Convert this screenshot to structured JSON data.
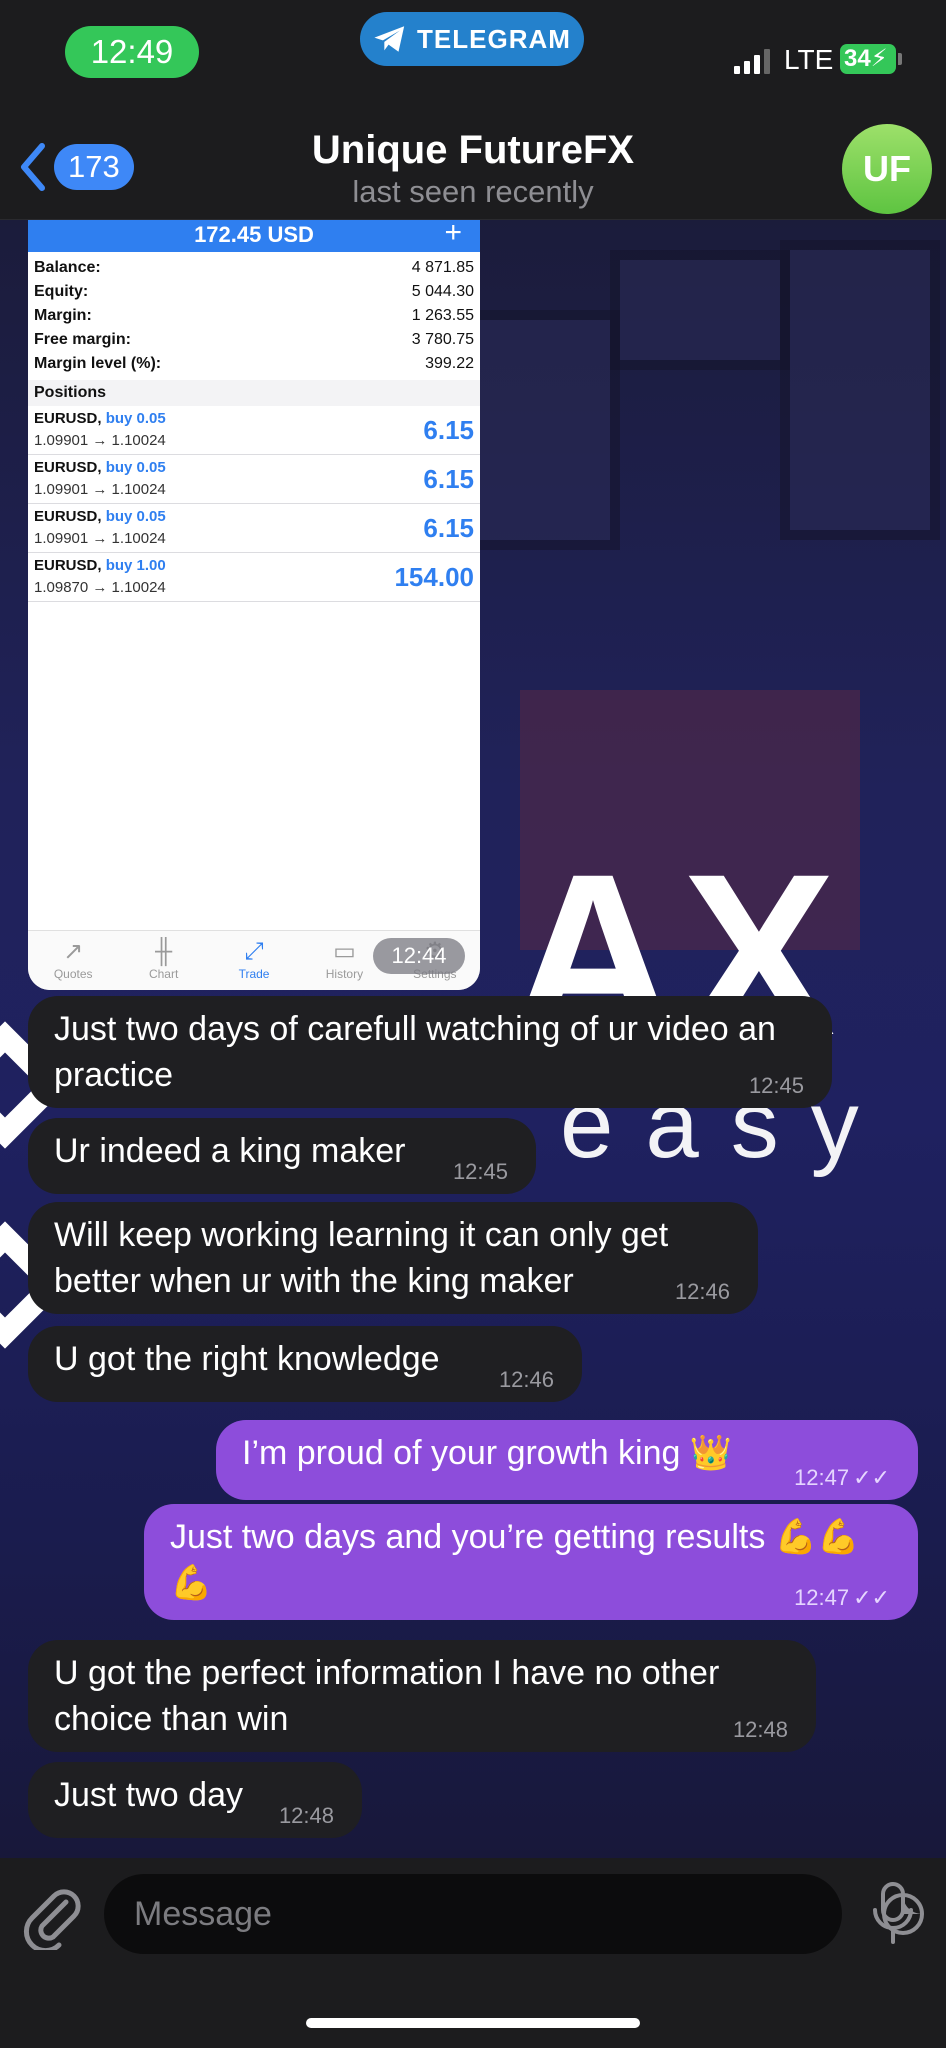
{
  "status": {
    "time": "12:49",
    "app_pill": "TELEGRAM",
    "network": "LTE",
    "battery": "34"
  },
  "header": {
    "back_count": "173",
    "title": "Unique FutureFX",
    "subtitle": "last seen recently",
    "avatar_initials": "UF"
  },
  "screenshot": {
    "top_value": "172.45 USD",
    "account": [
      {
        "label": "Balance:",
        "value": "4 871.85"
      },
      {
        "label": "Equity:",
        "value": "5 044.30"
      },
      {
        "label": "Margin:",
        "value": "1 263.55"
      },
      {
        "label": "Free margin:",
        "value": "3 780.75"
      },
      {
        "label": "Margin level (%):",
        "value": "399.22"
      }
    ],
    "positions_header": "Positions",
    "positions": [
      {
        "symbol": "EURUSD,",
        "side": "buy 0.05",
        "range": "1.09901 → 1.10024",
        "profit": "6.15"
      },
      {
        "symbol": "EURUSD,",
        "side": "buy 0.05",
        "range": "1.09901 → 1.10024",
        "profit": "6.15"
      },
      {
        "symbol": "EURUSD,",
        "side": "buy 0.05",
        "range": "1.09901 → 1.10024",
        "profit": "6.15"
      },
      {
        "symbol": "EURUSD,",
        "side": "buy 1.00",
        "range": "1.09870 → 1.10024",
        "profit": "154.00"
      }
    ],
    "tabs": [
      "Quotes",
      "Chart",
      "Trade",
      "History",
      "Settings"
    ],
    "time": "12:44"
  },
  "messages": [
    {
      "dir": "in",
      "text": "Just two days of carefull watching of ur video an practice",
      "time": "12:45"
    },
    {
      "dir": "in",
      "text": "Ur indeed a king maker",
      "time": "12:45"
    },
    {
      "dir": "in",
      "text": "Will keep working learning it can only get better when ur with the king maker",
      "time": "12:46"
    },
    {
      "dir": "in",
      "text": "U got the right knowledge",
      "time": "12:46"
    },
    {
      "dir": "out",
      "text": "I’m proud of your growth king 👑",
      "time": "12:47"
    },
    {
      "dir": "out",
      "text": "Just two days and you’re getting results 💪💪💪",
      "time": "12:47"
    },
    {
      "dir": "in",
      "text": "U got the perfect information I have no other choice than win",
      "time": "12:48"
    },
    {
      "dir": "in",
      "text": "Just two day",
      "time": "12:48"
    }
  ],
  "composer": {
    "placeholder": "Message"
  },
  "colors": {
    "incoming_bubble": "#1f1f22",
    "outgoing_bubble": "#8d4ddb",
    "accent": "#3e88f7",
    "status_green": "#34c759"
  }
}
